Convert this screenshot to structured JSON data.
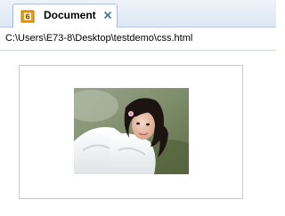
{
  "tab": {
    "label": "Document",
    "icon": "html5-badge-icon",
    "close_icon": "close-icon",
    "badge_color": "#f2a20c"
  },
  "address": {
    "path": "C:\\Users\\E73-8\\Desktop\\testdemo\\css.html"
  },
  "content": {
    "image": "photo-of-girl-icon"
  }
}
